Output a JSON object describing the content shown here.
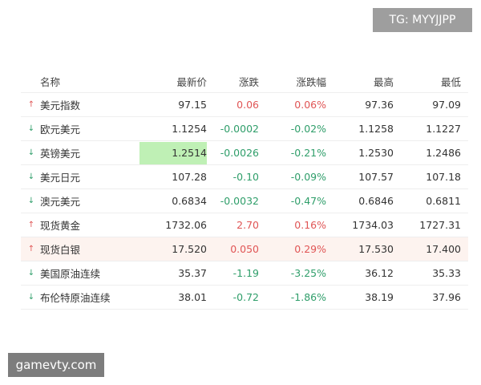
{
  "watermarks": {
    "top": "TG: MYYJJPP",
    "bottom": "gamevty.com"
  },
  "table": {
    "headers": {
      "name": "名称",
      "last": "最新价",
      "change": "涨跌",
      "change_pct": "涨跌幅",
      "high": "最高",
      "low": "最低"
    },
    "rows": [
      {
        "name": "美元指数",
        "last": "97.15",
        "change": "0.06",
        "change_pct": "0.06%",
        "high": "97.36",
        "low": "97.09",
        "direction": "up"
      },
      {
        "name": "欧元美元",
        "last": "1.1254",
        "change": "-0.0002",
        "change_pct": "-0.02%",
        "high": "1.1258",
        "low": "1.1227",
        "direction": "down"
      },
      {
        "name": "英镑美元",
        "last": "1.2514",
        "change": "-0.0026",
        "change_pct": "-0.21%",
        "high": "1.2530",
        "low": "1.2486",
        "direction": "down"
      },
      {
        "name": "美元日元",
        "last": "107.28",
        "change": "-0.10",
        "change_pct": "-0.09%",
        "high": "107.57",
        "low": "107.18",
        "direction": "down"
      },
      {
        "name": "澳元美元",
        "last": "0.6834",
        "change": "-0.0032",
        "change_pct": "-0.47%",
        "high": "0.6846",
        "low": "0.6811",
        "direction": "down"
      },
      {
        "name": "现货黄金",
        "last": "1732.06",
        "change": "2.70",
        "change_pct": "0.16%",
        "high": "1734.03",
        "low": "1727.31",
        "direction": "up"
      },
      {
        "name": "现货白银",
        "last": "17.520",
        "change": "0.050",
        "change_pct": "0.29%",
        "high": "17.530",
        "low": "17.400",
        "direction": "up"
      },
      {
        "name": "美国原油连续",
        "last": "35.37",
        "change": "-1.19",
        "change_pct": "-3.25%",
        "high": "36.12",
        "low": "35.33",
        "direction": "down"
      },
      {
        "name": "布伦特原油连续",
        "last": "38.01",
        "change": "-0.72",
        "change_pct": "-1.86%",
        "high": "38.19",
        "low": "37.96",
        "direction": "down"
      }
    ]
  },
  "colors": {
    "up": "#e05555",
    "down": "#2f9e6a",
    "flash": "#bff0b5",
    "highlight_row": "#fdf3ef"
  },
  "icons": {
    "up": "arrow-up-icon",
    "down": "arrow-down-icon"
  }
}
